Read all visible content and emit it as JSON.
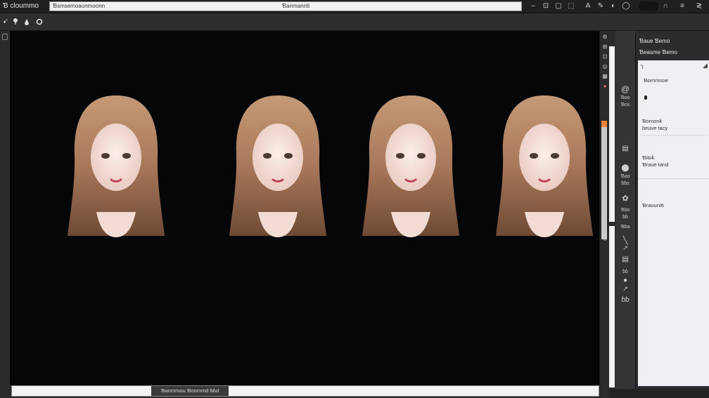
{
  "app": {
    "title": "Ɓ cloummo"
  },
  "topbar": {
    "file_field_value": "Ɓsmsemoaonmoonn",
    "doc_name": "Ɓanmannti",
    "buttons": [
      "–",
      "⊡",
      "▢",
      "⬚",
      "A",
      "✎",
      "◐",
      "◯",
      "∩",
      "≡",
      "≷"
    ]
  },
  "toolbar2": {
    "icons": [
      "pointer-icon",
      "pin-icon",
      "drop-icon",
      "refresh-icon"
    ]
  },
  "canvas": {
    "background": "#050608",
    "figure_count": 4
  },
  "statusbar": {
    "tab_label": "Ɓanmmou Ɓonmmd ɓɓd"
  },
  "tool_column": {
    "items": [
      "Ɓoo",
      "Ɓos",
      "▤",
      "Ɓao",
      "ɓɓs",
      "Ɓbs",
      "ɓɓ",
      "Ɓba",
      "ɓɓ",
      "ɓɓ"
    ]
  },
  "right_panel": {
    "title": "Ɓaue Ɓemo",
    "subtitle": "Ɓeasme Ɓemo",
    "section1": "Ɓommnoe",
    "entry1_line1": "Ɓomonƙ",
    "entry1_line2": "beuve tacy",
    "entry2_line1": "Ɓitoƙ",
    "entry2_line2": "Ɓraue tand",
    "entry3": "Ɓraounitt"
  },
  "colors": {
    "accent": "#e8843a",
    "canvas_bg": "#050608",
    "panel_bg": "#eef0f3"
  }
}
